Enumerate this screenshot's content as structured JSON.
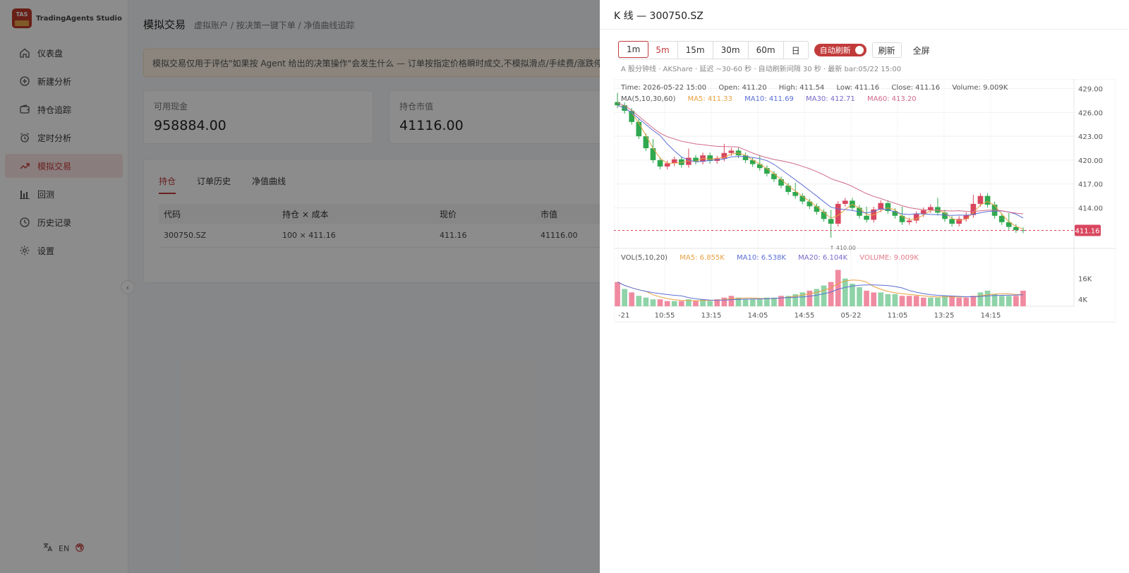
{
  "brand": {
    "name": "TradingAgents Studio",
    "logo_text": "TAS"
  },
  "nav": [
    {
      "label": "仪表盘",
      "icon": "home-icon"
    },
    {
      "label": "新建分析",
      "icon": "plus-circle-icon"
    },
    {
      "label": "持仓追踪",
      "icon": "wallet-icon"
    },
    {
      "label": "定时分析",
      "icon": "alarm-clock-icon"
    },
    {
      "label": "模拟交易",
      "icon": "trend-up-icon"
    },
    {
      "label": "回测",
      "icon": "bar-chart-icon"
    },
    {
      "label": "历史记录",
      "icon": "clock-icon"
    },
    {
      "label": "设置",
      "icon": "gear-icon"
    }
  ],
  "footer": {
    "lang": "EN"
  },
  "page": {
    "title": "模拟交易",
    "subtitle": "虚拟账户 / 按决策一键下单 / 净值曲线追踪",
    "notice": "模拟交易仅用于评估\"如果按 Agent 给出的决策操作\"会发生什么 — 订单按指定价格瞬时成交,不模拟滑点/手续费/涨跌停。任"
  },
  "stats": [
    {
      "label": "可用现金",
      "value": "958884.00"
    },
    {
      "label": "持仓市值",
      "value": "41116.00"
    }
  ],
  "tabs": [
    "持仓",
    "订单历史",
    "净值曲线"
  ],
  "table": {
    "headers": [
      "代码",
      "持仓 × 成本",
      "现价",
      "市值"
    ],
    "rows": [
      [
        "300750.SZ",
        "100 × 411.16",
        "411.16",
        "41116.00"
      ]
    ]
  },
  "drawer": {
    "title": "K 线 — 300750.SZ",
    "intervals": [
      "1m",
      "5m",
      "15m",
      "30m",
      "60m",
      "日"
    ],
    "auto_refresh": "自动刷新",
    "refresh": "刷新",
    "fullscreen": "全屏",
    "meta": "A 股分钟线 · AKShare · 延迟 ~30-60 秒 · 自动刷新间隔 30 秒 · 最新 bar:05/22 15:00"
  },
  "colors": {
    "up": "#d9475f",
    "down": "#2fa84f",
    "ma5": "#e8a040",
    "ma10": "#5b6fd6",
    "ma30": "#7b68c8",
    "ma60": "#d06a8a",
    "accent": "#c23b3b"
  },
  "chart_data": {
    "type": "candlestick",
    "symbol": "300750.SZ",
    "ohlc_info": {
      "time": "Time: 2026-05-22 15:00",
      "open": "Open: 411.20",
      "high": "High: 411.54",
      "low": "Low: 411.16",
      "close": "Close: 411.16",
      "volume": "Volume: 9.009K"
    },
    "ma_legend": {
      "label": "MA(5,10,30,60)",
      "ma5": "MA5: 411.33",
      "ma10": "MA10: 411.69",
      "ma30": "MA30: 412.71",
      "ma60": "MA60: 413.20"
    },
    "vol_legend": {
      "label": "VOL(5,10,20)",
      "ma5": "MA5: 6.855K",
      "ma10": "MA10: 6.538K",
      "ma20": "MA20: 6.104K",
      "volume": "VOLUME: 9.009K"
    },
    "y_ticks": [
      "429.00",
      "426.00",
      "423.00",
      "420.00",
      "417.00",
      "414.00"
    ],
    "ylim": [
      408.9,
      430.2
    ],
    "vol_ticks": [
      "16K",
      "4K"
    ],
    "x_ticks": [
      "-21",
      "10:55",
      "13:15",
      "14:05",
      "14:55",
      "05-22",
      "11:05",
      "13:25",
      "14:15"
    ],
    "last_price": "411.16",
    "low_marker": "410.00",
    "close": [
      426.9,
      426.2,
      424.8,
      423.0,
      421.5,
      420.0,
      419.2,
      419.6,
      420.1,
      419.4,
      420.3,
      419.8,
      420.6,
      419.9,
      420.2,
      420.9,
      421.2,
      420.6,
      420.0,
      419.5,
      419.0,
      418.3,
      417.6,
      416.8,
      416.0,
      415.5,
      414.8,
      414.2,
      413.5,
      412.6,
      412.0,
      414.5,
      414.9,
      414.0,
      413.0,
      412.5,
      413.8,
      414.6,
      413.6,
      413.0,
      412.2,
      412.4,
      413.2,
      413.7,
      414.1,
      413.4,
      412.6,
      412.0,
      412.6,
      413.1,
      414.5,
      415.5,
      414.4,
      413.0,
      412.2,
      411.6,
      411.2,
      411.16
    ],
    "volumes": [
      14,
      10,
      8,
      6,
      5,
      4,
      4,
      3,
      3,
      3,
      4,
      3,
      4,
      3,
      4,
      5,
      6,
      5,
      4,
      4,
      4,
      5,
      5,
      6,
      6,
      7,
      8,
      9,
      10,
      12,
      14,
      21,
      16,
      13,
      11,
      9,
      8,
      8,
      7,
      7,
      6,
      6,
      6,
      5,
      5,
      5,
      6,
      6,
      5,
      5,
      6,
      8,
      9,
      7,
      6,
      6,
      6,
      9.0
    ],
    "vol_up": [
      true,
      false,
      true,
      false,
      false,
      false,
      true,
      true,
      false,
      true,
      false,
      true,
      false,
      false,
      true,
      true,
      true,
      false,
      false,
      false,
      false,
      false,
      false,
      true,
      false,
      false,
      false,
      true,
      false,
      false,
      true,
      true,
      false,
      false,
      false,
      true,
      true,
      false,
      false,
      false,
      true,
      true,
      true,
      true,
      false,
      false,
      false,
      true,
      true,
      true,
      true,
      false,
      false,
      false,
      false,
      false,
      true,
      true
    ]
  }
}
